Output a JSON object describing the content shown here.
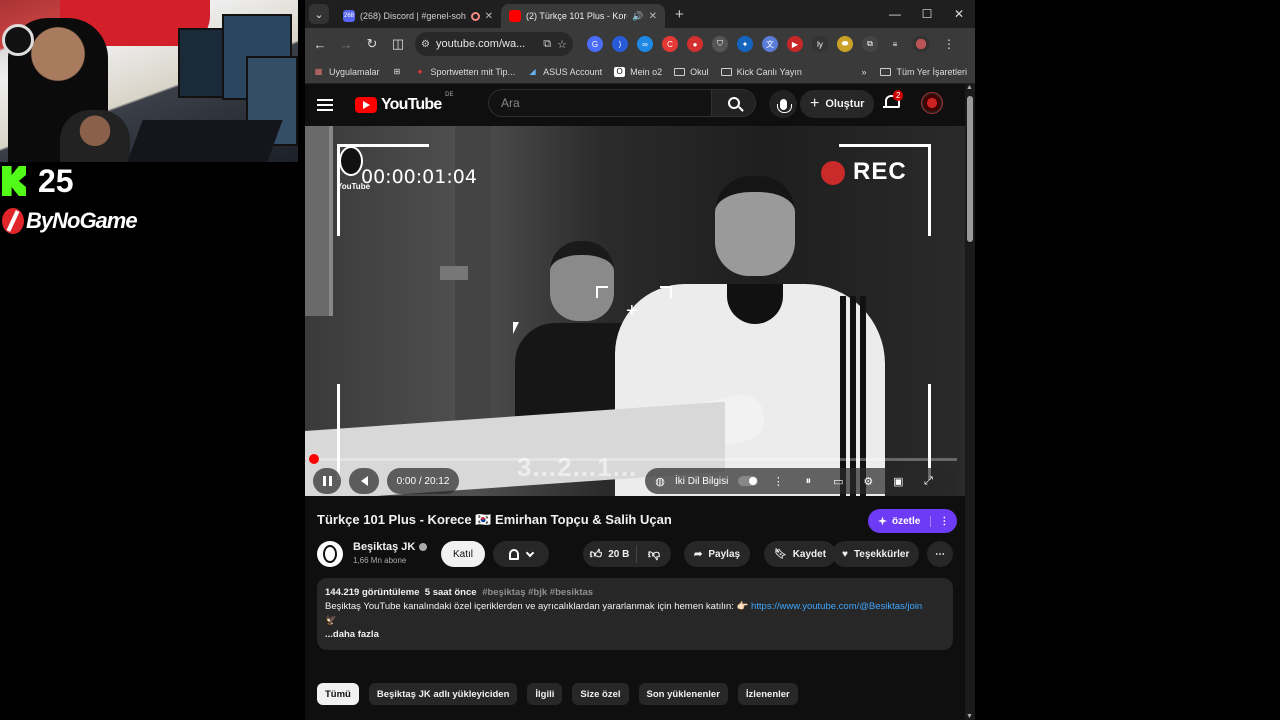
{
  "overlay": {
    "kick_count": "25",
    "bynogame_text": "ByNoGame"
  },
  "browser": {
    "tabs": [
      {
        "title": "(268) Discord | #genel-soh",
        "favicon": "discord-icon",
        "badge": "268",
        "active": false
      },
      {
        "title": "(2) Türkçe 101 Plus - Korece",
        "favicon": "youtube-icon",
        "active": true
      }
    ],
    "url": "youtube.com/wa...",
    "bookmarks": [
      {
        "label": "Uygulamalar",
        "icon": "apps-icon"
      },
      {
        "label": "",
        "icon": "grid-icon"
      },
      {
        "label": "Sportwetten mit Tip...",
        "icon": "sportwetten-icon"
      },
      {
        "label": "ASUS Account",
        "icon": "asus-icon"
      },
      {
        "label": "Mein o2",
        "icon": "o2-icon"
      },
      {
        "label": "Okul",
        "icon": "folder-icon"
      },
      {
        "label": "Kick Canlı Yayın",
        "icon": "folder-icon"
      }
    ],
    "bookmarks_more": "»",
    "all_bookmarks": "Tüm Yer İşaretleri"
  },
  "youtube": {
    "logo_text": "YouTube",
    "country_code": "DE",
    "search_placeholder": "Ara",
    "create_label": "Oluştur",
    "notification_count": "2",
    "video": {
      "timecode_overlay": "00:00:01:04",
      "rec_label": "REC",
      "countdown_text": "3...2...1...",
      "channel_watermark": "YouTube",
      "time_display": "0:00 / 20:12",
      "progress_fraction": 0.0,
      "audio_track_label": "İki Dil Bilgisi"
    },
    "title": "Türkçe 101 Plus - Korece 🇰🇷 Emirhan Topçu & Salih Uçan",
    "summarize_label": "özetle",
    "channel": {
      "name": "Beşiktaş JK",
      "subscribers": "1,66 Mn abone",
      "join_label": "Katıl"
    },
    "actions": {
      "likes": "20 B",
      "share": "Paylaş",
      "save": "Kaydet",
      "thanks": "Teşekkürler"
    },
    "description": {
      "views": "144.219 görüntüleme",
      "age": "5 saat önce",
      "tags": "#beşiktaş #bjk #besiktas",
      "text": "Beşiktaş YouTube kanalındaki özel içeriklerden ve ayrıcalıklardan yararlanmak için hemen katılın: 👉🏻",
      "link": "https://www.youtube.com/@Besiktas/join",
      "emoji_line": "🦅",
      "more": "...daha fazla"
    },
    "chips": [
      "Tümü",
      "Beşiktaş JK adlı yükleyiciden",
      "İlgili",
      "Size özel",
      "Son yüklenenler",
      "İzlenenler"
    ]
  },
  "colors": {
    "youtube_red": "#ff0000",
    "summarize_purple": "#6d3bf5",
    "link_blue": "#3ea6ff",
    "kick_green": "#53fc18"
  }
}
